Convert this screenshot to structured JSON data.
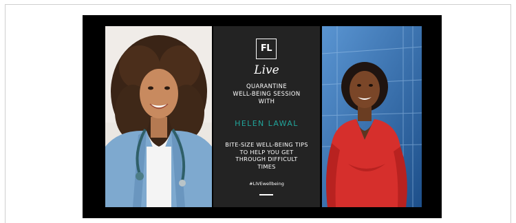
{
  "banner": {
    "logo_text": "FL",
    "live_text": "Live",
    "session_title": "QUARANTINE\nWELL-BEING SESSION\nWITH",
    "host_name": "HELEN LAWAL",
    "tagline": "BITE-SIZE WELL-BEING TIPS\nTO HELP YOU GET\nTHROUGH DIFFICULT\nTIMES",
    "hashtag": "#LIVEwellbeing"
  },
  "photos": {
    "left": "woman-doctor-with-stethoscope",
    "right": "woman-in-red-dress"
  },
  "colors": {
    "accent_teal": "#21a59b",
    "panel_dark": "#232323",
    "dress_red": "#d62f2c",
    "scrub_blue": "#7ea9cf"
  }
}
